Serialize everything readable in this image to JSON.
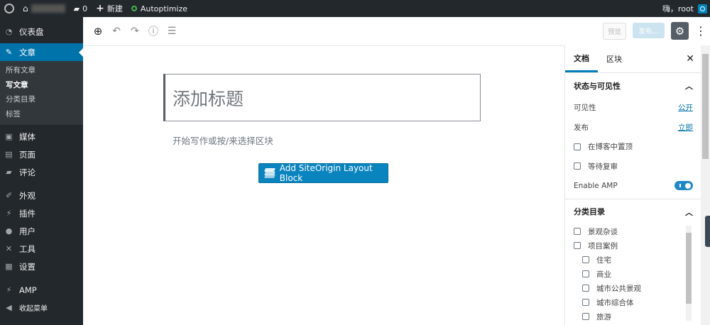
{
  "adminbar": {
    "comments_count": "0",
    "new_label": "新建",
    "plugin_label": "Autoptimize",
    "greeting": "嗨，root"
  },
  "sidebar": {
    "items": [
      {
        "label": "仪表盘",
        "icon": "dashboard-icon"
      },
      {
        "label": "文章",
        "icon": "pin-icon",
        "active": true
      },
      {
        "label": "媒体",
        "icon": "media-icon"
      },
      {
        "label": "页面",
        "icon": "page-icon"
      },
      {
        "label": "评论",
        "icon": "comment-icon"
      },
      {
        "label": "外观",
        "icon": "brush-icon"
      },
      {
        "label": "插件",
        "icon": "plugin-icon"
      },
      {
        "label": "用户",
        "icon": "user-icon"
      },
      {
        "label": "工具",
        "icon": "wrench-icon"
      },
      {
        "label": "设置",
        "icon": "settings-icon"
      },
      {
        "label": "AMP",
        "icon": "amp-icon"
      },
      {
        "label": "收起菜单",
        "icon": "collapse-icon"
      }
    ],
    "submenu": [
      "所有文章",
      "写文章",
      "分类目录",
      "标签"
    ]
  },
  "header": {
    "preview_label": "预览",
    "publish_label": "发布..."
  },
  "editor": {
    "title_placeholder": "添加标题",
    "body_placeholder": "开始写作或按/来选择区块",
    "siteorigin_button": "Add SiteOrigin Layout Block"
  },
  "panel": {
    "tabs": [
      "文档",
      "区块"
    ],
    "status_section": "状态与可见性",
    "visibility_label": "可见性",
    "visibility_value": "公开",
    "publish_label": "发布",
    "publish_value": "立即",
    "sticky_label": "在博客中置顶",
    "pending_label": "等待复审",
    "amp_label": "Enable AMP",
    "amp_enabled": true,
    "categories_section": "分类目录",
    "categories": [
      {
        "label": "景观杂谈",
        "child": false
      },
      {
        "label": "项目案例",
        "child": false
      },
      {
        "label": "住宅",
        "child": true
      },
      {
        "label": "商业",
        "child": true
      },
      {
        "label": "城市公共景观",
        "child": true
      },
      {
        "label": "城市综合体",
        "child": true
      },
      {
        "label": "旅游",
        "child": true
      }
    ]
  },
  "colors": {
    "adminbar_bg": "#23282d",
    "accent": "#0073aa",
    "button_blue": "#0a84bf"
  }
}
